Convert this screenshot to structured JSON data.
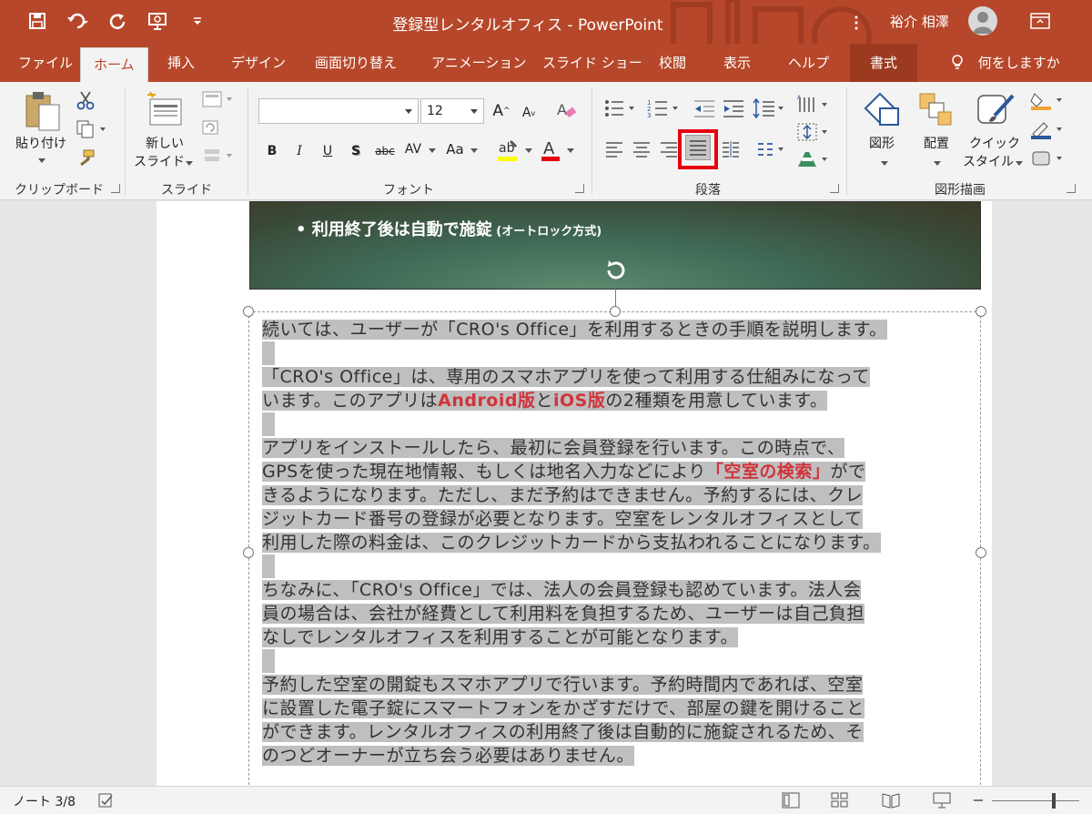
{
  "window": {
    "title": "登録型レンタルオフィス - PowerPoint",
    "user": "裕介 相澤"
  },
  "tabs": [
    "ファイル",
    "ホーム",
    "挿入",
    "デザイン",
    "画面切り替え",
    "アニメーション",
    "スライド ショー",
    "校閲",
    "表示",
    "ヘルプ",
    "書式"
  ],
  "tell_me": "何をしますか",
  "ribbon": {
    "clipboard": {
      "label": "クリップボード",
      "paste": "貼り付け"
    },
    "slides": {
      "label": "スライド",
      "new_slide_1": "新しい",
      "new_slide_2": "スライド"
    },
    "font": {
      "label": "フォント",
      "font_name": "",
      "font_size": "12",
      "bold": "B",
      "italic": "I",
      "underline": "U",
      "shadow": "S",
      "strike": "abc",
      "spacing": "AV",
      "case": "Aa"
    },
    "paragraph": {
      "label": "段落"
    },
    "drawing": {
      "label": "図形描画",
      "shapes": "図形",
      "arrange": "配置",
      "quick_1": "クイック",
      "quick_2": "スタイル"
    }
  },
  "slide": {
    "bullet": "• 利用終了後は自動で施錠",
    "bullet_small": " (オートロック方式)"
  },
  "notes": {
    "p1": "続いては、ユーザーが「CRO's Office」を利用するときの手順を説明します。",
    "p2a": "「CRO's Office」は、専用のスマホアプリを使って利用する仕組みになって",
    "p2b_1": "います。このアプリは",
    "p2b_red1": "Android版",
    "p2b_2": "と",
    "p2b_red2": "iOS版",
    "p2b_3": "の2種類を用意しています。",
    "p3a": "アプリをインストールしたら、最初に会員登録を行います。この時点で、",
    "p3b_1": "GPSを使った現在地情報、もしくは地名入力などにより",
    "p3b_red": "「空室の検索」",
    "p3b_2": "がで",
    "p3c": "きるようになります。ただし、まだ予約はできません。予約するには、クレ",
    "p3d": "ジットカード番号の登録が必要となります。空室をレンタルオフィスとして",
    "p3e": "利用した際の料金は、このクレジットカードから支払われることになります。",
    "p4a": "ちなみに、「CRO's Office」では、法人の会員登録も認めています。法人会",
    "p4b": "員の場合は、会社が経費として利用料を負担するため、ユーザーは自己負担",
    "p4c": "なしでレンタルオフィスを利用することが可能となります。",
    "p5a": "予約した空室の開錠もスマホアプリで行います。予約時間内であれば、空室",
    "p5b": "に設置した電子錠にスマートフォンをかざすだけで、部屋の鍵を開けること",
    "p5c": "ができます。レンタルオフィスの利用終了後は自動的に施錠されるため、そ",
    "p5d": "のつどオーナーが立ち会う必要はありません。"
  },
  "status": {
    "page": "ノート 3/8"
  },
  "colors": {
    "accent": "#b7472a",
    "highlight": "#e60012",
    "emphasis": "#d0343b"
  }
}
